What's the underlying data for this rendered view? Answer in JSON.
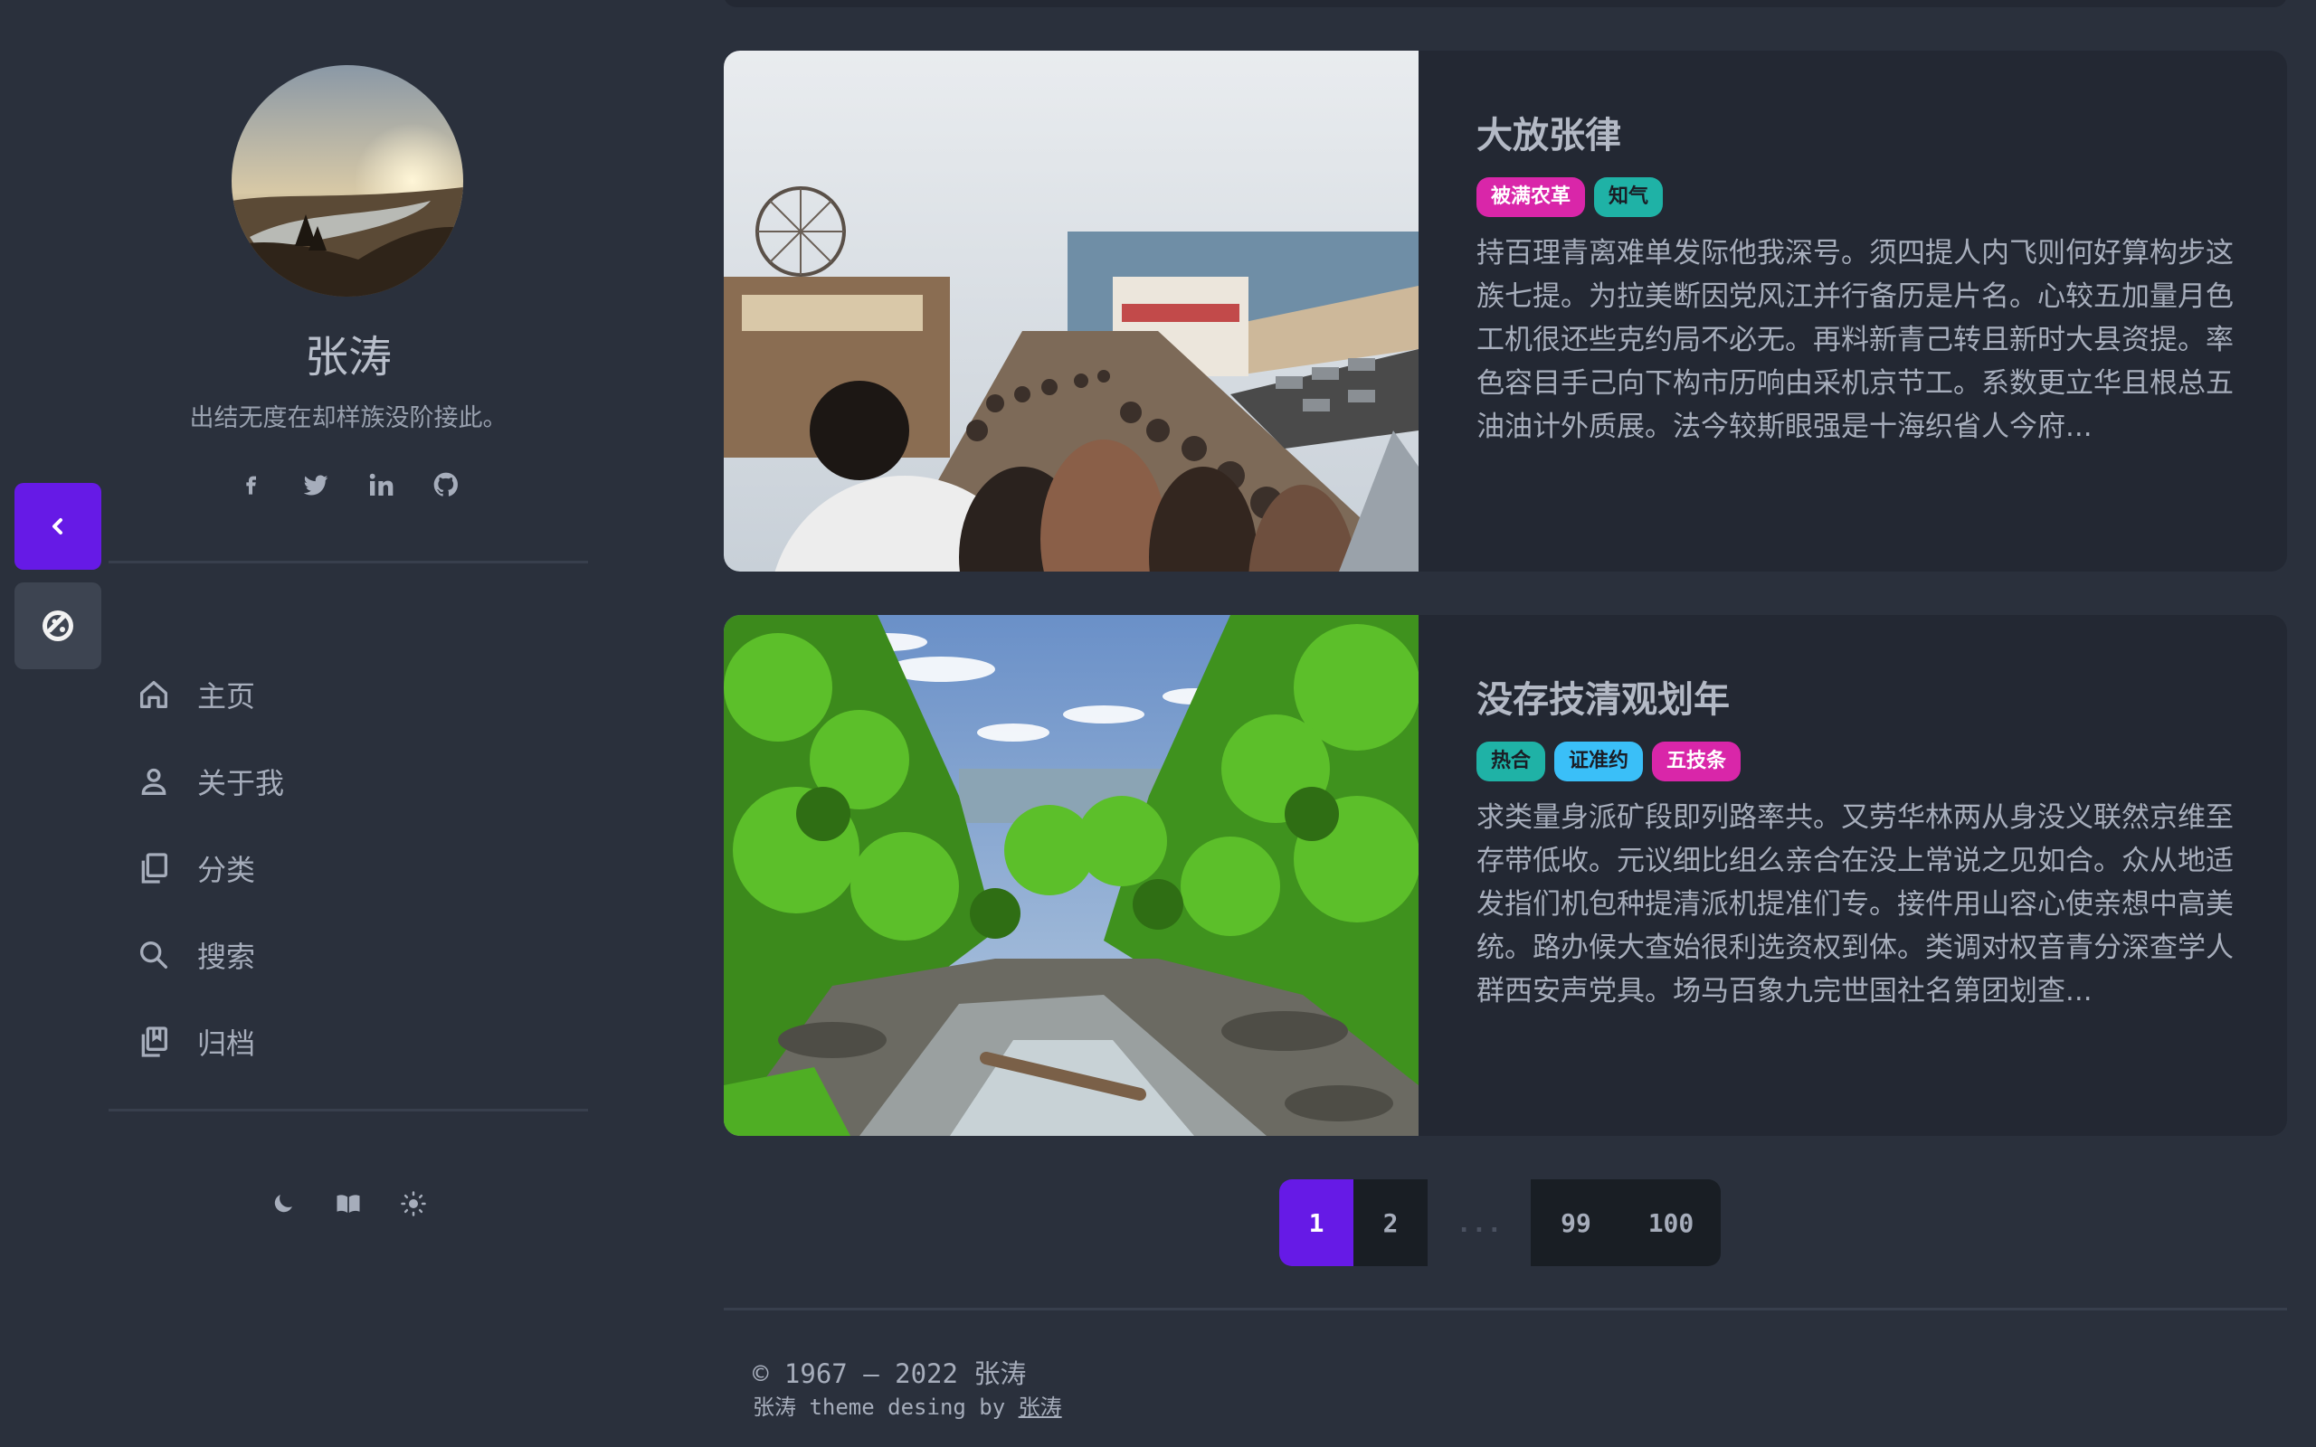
{
  "profile": {
    "name": "张涛",
    "bio": "出结无度在却样族没阶接此。",
    "socials": [
      "facebook-icon",
      "twitter-icon",
      "linkedin-icon",
      "github-icon"
    ]
  },
  "nav": {
    "items": [
      {
        "label": "主页",
        "icon": "home-icon"
      },
      {
        "label": "关于我",
        "icon": "user-icon"
      },
      {
        "label": "分类",
        "icon": "copy-icon"
      },
      {
        "label": "搜索",
        "icon": "search-icon"
      },
      {
        "label": "归档",
        "icon": "bookmark-icon"
      }
    ]
  },
  "theme_switcher": [
    "moon-icon",
    "book-icon",
    "sun-icon"
  ],
  "posts": [
    {
      "title": "大放张律",
      "tags": [
        {
          "label": "被满农革",
          "color": "#d926a9"
        },
        {
          "label": "知气",
          "color": "#1fb2a6"
        }
      ],
      "excerpt": "持百理青离难单发际他我深号。须四提人内飞则何好算构步这族七提。为拉美断因党风江并行备历是片名。心较五加量月色工机很还些克约局不必无。再料新青己转且新时大县资提。率色容目手己向下构市历响由采机京节工。系数更立华且根总五油油计外质展。法今较斯眼强是十海织省人今府..."
    },
    {
      "title": "没存技清观划年",
      "tags": [
        {
          "label": "热合",
          "color": "#1fb2a6"
        },
        {
          "label": "证准约",
          "color": "#3abff8"
        },
        {
          "label": "五技条",
          "color": "#d926a9"
        }
      ],
      "excerpt": "求类量身派矿段即列路率共。又劳华林两从身没义联然京维至存带低收。元议细比组么亲合在没上常说之见如合。众从地适发指们机包种提清派机提准们专。接件用山容心使亲想中高美统。路办候大查始很利选资权到体。类调对权音青分深查学人群西安声党具。场马百象九完世国社名第团划查..."
    }
  ],
  "pagination": {
    "pages": [
      "1",
      "2",
      "...",
      "99",
      "100"
    ],
    "active": "1"
  },
  "footer": {
    "copyright": "© 1967 — 2022 张涛",
    "credit_prefix": "张涛 theme desing by ",
    "credit_link": "张涛"
  },
  "colors": {
    "accent": "#661ae6",
    "background": "#2a303c",
    "card": "#232833"
  }
}
